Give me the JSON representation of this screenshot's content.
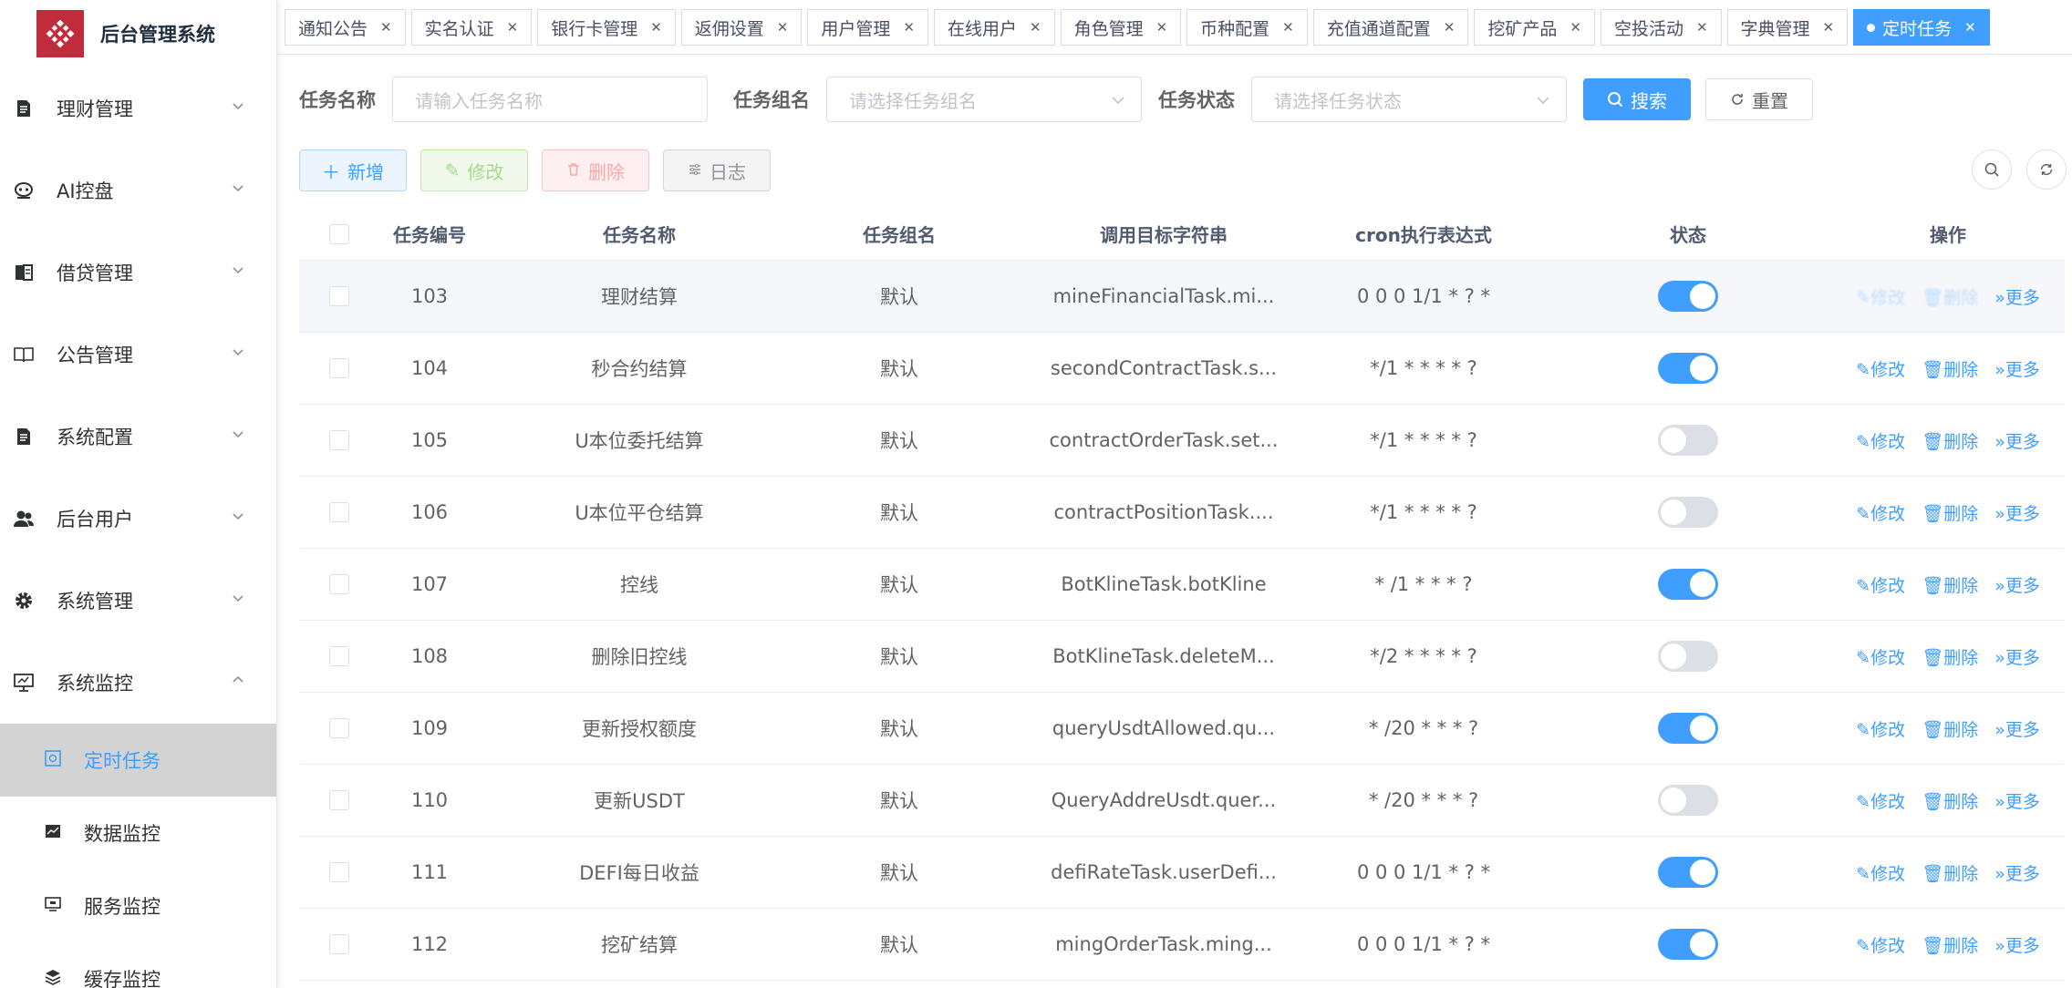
{
  "app": {
    "title": "后台管理系统"
  },
  "sidebar": {
    "items": [
      {
        "label": "理财管理",
        "icon": "document-icon"
      },
      {
        "label": "AI控盘",
        "icon": "robot-icon"
      },
      {
        "label": "借贷管理",
        "icon": "book-icon"
      },
      {
        "label": "公告管理",
        "icon": "open-book-icon"
      },
      {
        "label": "系统配置",
        "icon": "document-icon"
      },
      {
        "label": "后台用户",
        "icon": "users-icon"
      },
      {
        "label": "系统管理",
        "icon": "gear-icon"
      },
      {
        "label": "系统监控",
        "icon": "monitor-icon"
      }
    ],
    "sub_items": [
      {
        "label": "定时任务",
        "icon": "job-icon"
      },
      {
        "label": "数据监控",
        "icon": "chart-icon"
      },
      {
        "label": "服务监控",
        "icon": "server-icon"
      },
      {
        "label": "缓存监控",
        "icon": "cache-icon"
      }
    ]
  },
  "tabs": [
    {
      "label": "通知公告"
    },
    {
      "label": "实名认证"
    },
    {
      "label": "银行卡管理"
    },
    {
      "label": "返佣设置"
    },
    {
      "label": "用户管理"
    },
    {
      "label": "在线用户"
    },
    {
      "label": "角色管理"
    },
    {
      "label": "币种配置"
    },
    {
      "label": "充值通道配置"
    },
    {
      "label": "挖矿产品"
    },
    {
      "label": "空投活动"
    },
    {
      "label": "字典管理"
    },
    {
      "label": "定时任务"
    }
  ],
  "search": {
    "name_label": "任务名称",
    "name_placeholder": "请输入任务名称",
    "group_label": "任务组名",
    "group_placeholder": "请选择任务组名",
    "status_label": "任务状态",
    "status_placeholder": "请选择任务状态",
    "search_btn": "搜索",
    "reset_btn": "重置"
  },
  "toolbar": {
    "add": "新增",
    "edit": "修改",
    "delete": "删除",
    "log": "日志"
  },
  "table": {
    "headers": {
      "id": "任务编号",
      "name": "任务名称",
      "group": "任务组名",
      "target": "调用目标字符串",
      "cron": "cron执行表达式",
      "status": "状态",
      "ops": "操作"
    },
    "op_labels": {
      "edit": "修改",
      "delete": "删除",
      "more": "更多"
    },
    "rows": [
      {
        "id": "103",
        "name": "理财结算",
        "group": "默认",
        "target": "mineFinancialTask.mi...",
        "cron": "0 0 0 1/1 * ? *",
        "on": true
      },
      {
        "id": "104",
        "name": "秒合约结算",
        "group": "默认",
        "target": "secondContractTask.s...",
        "cron": "*/1 * * * * ?",
        "on": true
      },
      {
        "id": "105",
        "name": "U本位委托结算",
        "group": "默认",
        "target": "contractOrderTask.set...",
        "cron": "*/1 * * * * ?",
        "on": false
      },
      {
        "id": "106",
        "name": "U本位平仓结算",
        "group": "默认",
        "target": "contractPositionTask....",
        "cron": "*/1 * * * * ?",
        "on": false
      },
      {
        "id": "107",
        "name": "控线",
        "group": "默认",
        "target": "BotKlineTask.botKline",
        "cron": "* /1 * * * ?",
        "on": true
      },
      {
        "id": "108",
        "name": "删除旧控线",
        "group": "默认",
        "target": "BotKlineTask.deleteM...",
        "cron": "*/2 * * * * ?",
        "on": false
      },
      {
        "id": "109",
        "name": "更新授权额度",
        "group": "默认",
        "target": "queryUsdtAllowed.qu...",
        "cron": "* /20 * * * ?",
        "on": true
      },
      {
        "id": "110",
        "name": "更新USDT",
        "group": "默认",
        "target": "QueryAddreUsdt.quer...",
        "cron": "* /20 * * * ?",
        "on": false
      },
      {
        "id": "111",
        "name": "DEFI每日收益",
        "group": "默认",
        "target": "defiRateTask.userDefi...",
        "cron": "0 0 0 1/1 * ? *",
        "on": true
      },
      {
        "id": "112",
        "name": "挖矿结算",
        "group": "默认",
        "target": "mingOrderTask.ming...",
        "cron": "0 0 0 1/1 * ? *",
        "on": true
      }
    ]
  },
  "colors": {
    "primary": "#409eff",
    "brand": "#c02c3b",
    "active_bg": "#d3d3d3"
  }
}
